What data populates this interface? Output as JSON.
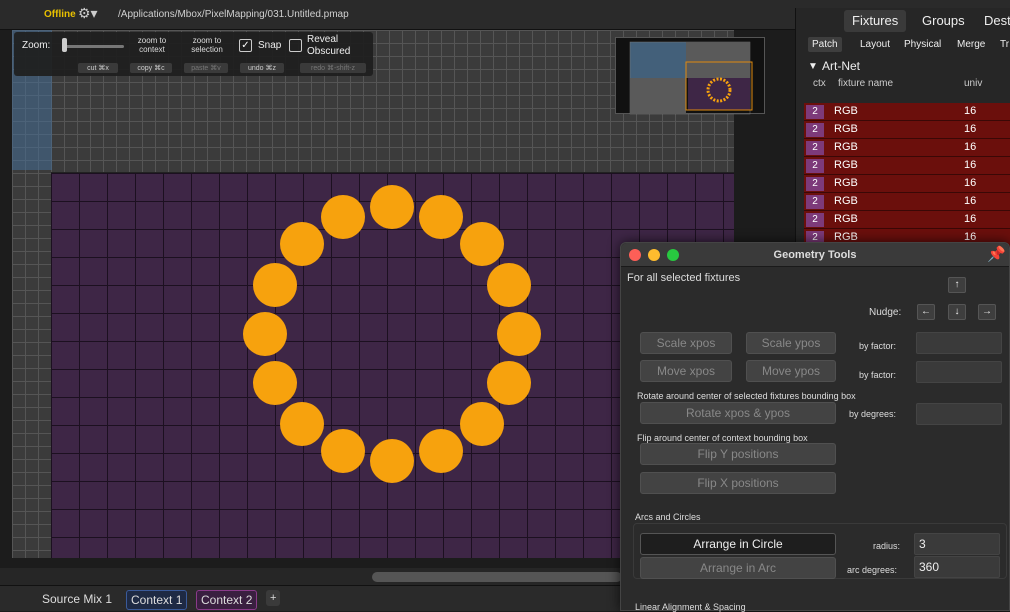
{
  "titlebar": {
    "status": "Offline",
    "file_path": "/Applications/Mbox/PixelMapping/031.Untitled.pmap"
  },
  "toolbar": {
    "zoom_label": "Zoom:",
    "zoom_to_context": "zoom to context",
    "zoom_to_selection": "zoom to selection",
    "snap_label": "Snap",
    "snap_checked": true,
    "reveal_obscured_label": "Reveal Obscured",
    "reveal_obscured_checked": false,
    "cut": "cut ⌘x",
    "copy": "copy ⌘c",
    "paste": "paste ⌘v",
    "undo": "undo ⌘z",
    "redo": "redo ⌘-shift-z"
  },
  "fixtures_panel": {
    "tabs": [
      "Fixtures",
      "Groups",
      "Dest"
    ],
    "subtabs": [
      "Patch",
      "Layout",
      "Physical",
      "Merge",
      "Tr"
    ],
    "group_title": "Art-Net",
    "columns": [
      "ctx",
      "fixture name",
      "univ"
    ],
    "rows": [
      {
        "ctx": "2",
        "name": "RGB",
        "univ": "16"
      },
      {
        "ctx": "2",
        "name": "RGB",
        "univ": "16"
      },
      {
        "ctx": "2",
        "name": "RGB",
        "univ": "16"
      },
      {
        "ctx": "2",
        "name": "RGB",
        "univ": "16"
      },
      {
        "ctx": "2",
        "name": "RGB",
        "univ": "16"
      },
      {
        "ctx": "2",
        "name": "RGB",
        "univ": "16"
      },
      {
        "ctx": "2",
        "name": "RGB",
        "univ": "16"
      },
      {
        "ctx": "2",
        "name": "RGB",
        "univ": "16"
      }
    ]
  },
  "bottom_tabs": [
    "Source Mix 1",
    "Context 1",
    "Context 2",
    "+"
  ],
  "geometry_tools": {
    "title": "Geometry Tools",
    "for_all": "For all selected fixtures",
    "nudge_label": "Nudge:",
    "scale_xpos": "Scale xpos",
    "scale_ypos": "Scale ypos",
    "by_factor": "by factor:",
    "move_xpos": "Move xpos",
    "move_ypos": "Move ypos",
    "rotate_caption": "Rotate around center of selected fixtures bounding box",
    "rotate_btn": "Rotate xpos & ypos",
    "by_degrees": "by degrees:",
    "flip_caption": "Flip around center of context bounding box",
    "flip_y": "Flip Y positions",
    "flip_x": "Flip X positions",
    "arcs_header": "Arcs and Circles",
    "arrange_circle": "Arrange in Circle",
    "radius_label": "radius:",
    "radius_value": "3",
    "arrange_arc": "Arrange in Arc",
    "arc_degrees_label": "arc degrees:",
    "arc_degrees_value": "360",
    "linear_header": "Linear Alignment & Spacing"
  },
  "colors": {
    "fixture": "#f7a20d",
    "grid_bg": "#3e2646",
    "row_bg": "#6b0f0c",
    "ctx_bg": "#7d3a7a",
    "offline": "#e8c000"
  }
}
